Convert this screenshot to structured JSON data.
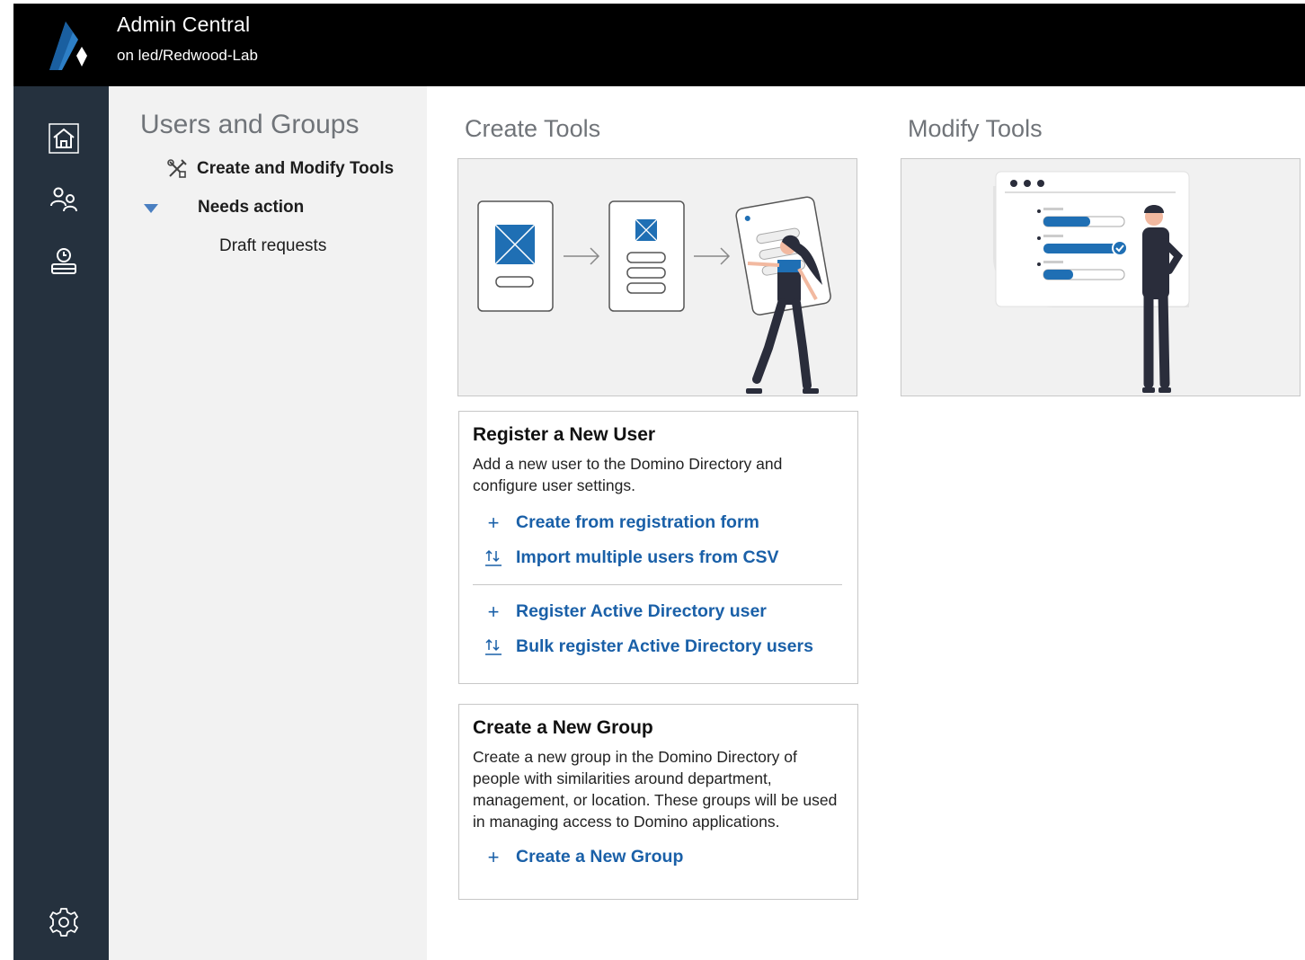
{
  "header": {
    "title": "Admin Central",
    "subtitle": "on led/Redwood-Lab",
    "logo_icon": "admin-central-logo"
  },
  "rail": {
    "items": [
      {
        "name": "home",
        "icon": "home-icon",
        "selected": true
      },
      {
        "name": "users",
        "icon": "users-icon"
      },
      {
        "name": "server",
        "icon": "server-clock-icon"
      }
    ],
    "settings_icon": "gear-icon"
  },
  "nav": {
    "title": "Users and Groups",
    "tools_label": "Create and Modify Tools",
    "needs_action_label": "Needs action",
    "draft_label": "Draft requests"
  },
  "main": {
    "create_title": "Create Tools",
    "modify_title": "Modify Tools",
    "register_card": {
      "title": "Register a New User",
      "description": "Add a new user to the Domino Directory and configure user settings.",
      "actions": [
        {
          "label": "Create from registration form",
          "icon": "plus-icon"
        },
        {
          "label": "Import multiple users from CSV",
          "icon": "import-icon"
        },
        {
          "label": "Register Active Directory user",
          "icon": "plus-icon"
        },
        {
          "label": "Bulk register Active Directory users",
          "icon": "import-icon"
        }
      ]
    },
    "group_card": {
      "title": "Create a New Group",
      "description": "Create a new group in the Domino Directory of people with similarities around department, management, or location.  These groups will be used in managing access to Domino applications.",
      "actions": [
        {
          "label": "Create a New Group",
          "icon": "plus-icon"
        }
      ]
    }
  },
  "colors": {
    "header_bg": "#000000",
    "rail_bg": "#25313e",
    "nav_bg": "#f2f2f2",
    "link": "#1a60a8",
    "accent_blue": "#1f6fb4"
  }
}
